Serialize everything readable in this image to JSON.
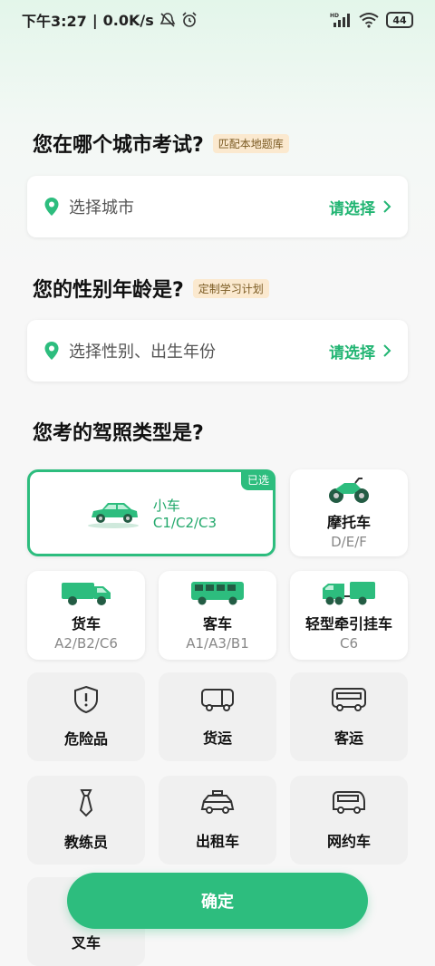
{
  "status_bar": {
    "time": "下午3:27",
    "speed": "0.0K/s",
    "battery": "44",
    "network": "HD"
  },
  "city_section": {
    "title": "您在哪个城市考试?",
    "tag": "匹配本地题库",
    "placeholder": "选择城市",
    "action": "请选择"
  },
  "gender_section": {
    "title": "您的性别年龄是?",
    "tag": "定制学习计划",
    "placeholder": "选择性别、出生年份",
    "action": "请选择"
  },
  "license_section": {
    "title": "您考的驾照类型是?",
    "selected_badge": "已选",
    "types": [
      {
        "name": "小车",
        "code": "C1/C2/C3",
        "selected": true
      },
      {
        "name": "摩托车",
        "code": "D/E/F"
      },
      {
        "name": "货车",
        "code": "A2/B2/C6"
      },
      {
        "name": "客车",
        "code": "A1/A3/B1"
      },
      {
        "name": "轻型牵引挂车",
        "code": "C6"
      }
    ],
    "qualifications": [
      {
        "name": "危险品"
      },
      {
        "name": "货运"
      },
      {
        "name": "客运"
      },
      {
        "name": "教练员"
      },
      {
        "name": "出租车"
      },
      {
        "name": "网约车"
      },
      {
        "name": "叉车"
      }
    ]
  },
  "confirm_label": "确定",
  "colors": {
    "accent": "#2dbd7e",
    "tag_bg": "#fbe9cf"
  }
}
